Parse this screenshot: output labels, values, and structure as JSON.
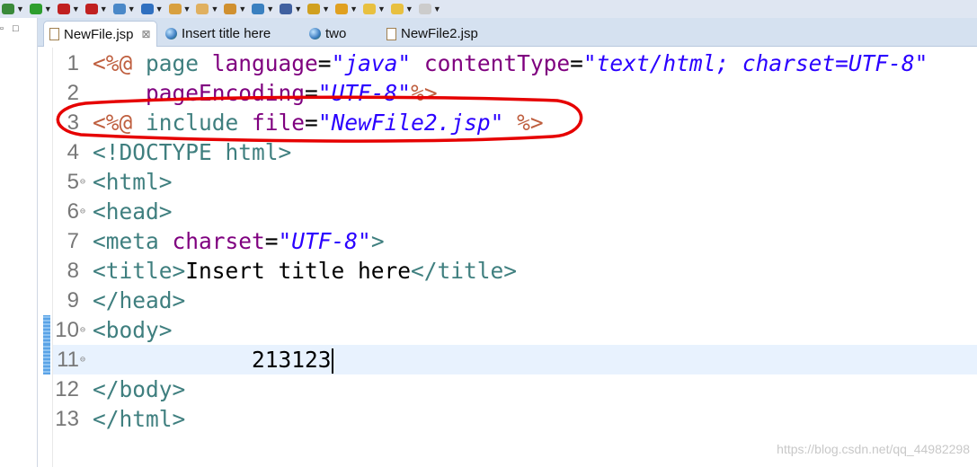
{
  "toolbar": {
    "icons": [
      "debug-icon",
      "run-icon",
      "run-config-icon",
      "stop-server-icon",
      "web-browser-icon",
      "spring-icon",
      "open-folder-icon",
      "open-file-icon",
      "brush-icon",
      "globe-icon",
      "search-icon",
      "annotation-icon",
      "up-arrow-icon",
      "back-icon",
      "forward-icon",
      "next-icon"
    ]
  },
  "tabs": [
    {
      "label": "NewFile.jsp",
      "icon": "jsp-file-icon",
      "active": true
    },
    {
      "label": "Insert title here",
      "icon": "globe-icon",
      "active": false
    },
    {
      "label": "two",
      "icon": "globe-icon",
      "active": false
    },
    {
      "label": "NewFile2.jsp",
      "icon": "jsp-file-icon",
      "active": false
    }
  ],
  "editor": {
    "current_line": 11,
    "highlight_color": "#e60000",
    "lines": [
      {
        "n": "1",
        "tokens": [
          [
            "dir",
            "<%@ "
          ],
          [
            "kw",
            "page "
          ],
          [
            "attr",
            "language"
          ],
          [
            "txt",
            "="
          ],
          [
            "val",
            "\"java\""
          ],
          [
            "txt",
            " "
          ],
          [
            "attr",
            "contentType"
          ],
          [
            "txt",
            "="
          ],
          [
            "val",
            "\"text/html; charset=UTF-8\""
          ]
        ]
      },
      {
        "n": "2",
        "tokens": [
          [
            "txt",
            "    "
          ],
          [
            "attr",
            "pageEncoding"
          ],
          [
            "txt",
            "="
          ],
          [
            "val",
            "\"UTF-8\""
          ],
          [
            "dir",
            "%>"
          ]
        ]
      },
      {
        "n": "3",
        "tokens": [
          [
            "dir",
            "<%@ "
          ],
          [
            "kw",
            "include "
          ],
          [
            "attr",
            "file"
          ],
          [
            "txt",
            "="
          ],
          [
            "val",
            "\"NewFile2.jsp\""
          ],
          [
            "txt",
            " "
          ],
          [
            "dir",
            "%>"
          ]
        ]
      },
      {
        "n": "4",
        "tokens": [
          [
            "tag",
            "<!DOCTYPE html>"
          ]
        ]
      },
      {
        "n": "5",
        "fold": true,
        "tokens": [
          [
            "tag",
            "<html>"
          ]
        ]
      },
      {
        "n": "6",
        "fold": true,
        "tokens": [
          [
            "tag",
            "<head>"
          ]
        ]
      },
      {
        "n": "7",
        "tokens": [
          [
            "tag",
            "<meta "
          ],
          [
            "attr",
            "charset"
          ],
          [
            "txt",
            "="
          ],
          [
            "val",
            "\"UTF-8\""
          ],
          [
            "tag",
            ">"
          ]
        ]
      },
      {
        "n": "8",
        "tokens": [
          [
            "tag",
            "<title>"
          ],
          [
            "txt",
            "Insert title here"
          ],
          [
            "tag",
            "</title>"
          ]
        ]
      },
      {
        "n": "9",
        "tokens": [
          [
            "tag",
            "</head>"
          ]
        ]
      },
      {
        "n": "10",
        "fold": true,
        "mark": true,
        "tokens": [
          [
            "tag",
            "<body>"
          ]
        ]
      },
      {
        "n": "11",
        "fold": true,
        "mark": true,
        "tokens": [
          [
            "txt",
            "            213123"
          ]
        ]
      },
      {
        "n": "12",
        "tokens": [
          [
            "tag",
            "</body>"
          ]
        ]
      },
      {
        "n": "13",
        "tokens": [
          [
            "tag",
            "</html>"
          ]
        ]
      }
    ]
  },
  "watermark": "https://blog.csdn.net/qq_44982298"
}
